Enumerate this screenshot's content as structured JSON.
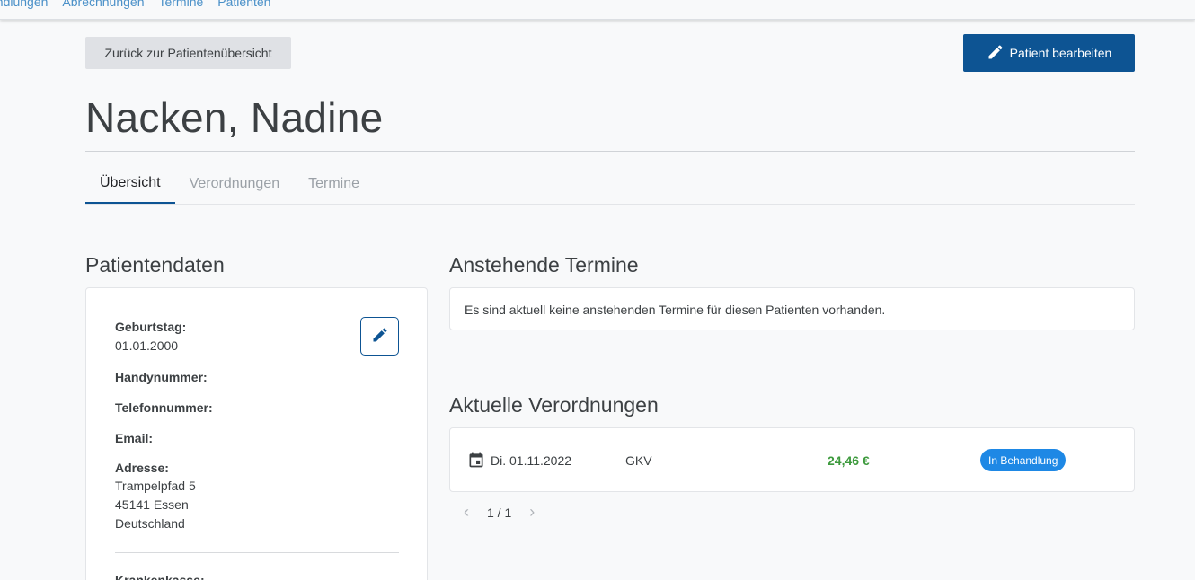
{
  "topnav": {
    "links": [
      "andlungen",
      "Abrechnungen",
      "Termine",
      "Patienten"
    ]
  },
  "header": {
    "back_label": "Zurück zur Patientenübersicht",
    "edit_label": "Patient bearbeiten",
    "title": "Nacken, Nadine"
  },
  "tabs": [
    {
      "label": "Übersicht",
      "active": true
    },
    {
      "label": "Verordnungen",
      "active": false
    },
    {
      "label": "Termine",
      "active": false
    }
  ],
  "patient_data": {
    "heading": "Patientendaten",
    "birthday_label": "Geburtstag:",
    "birthday_value": "01.01.2000",
    "mobile_label": "Handynummer:",
    "phone_label": "Telefonnummer:",
    "email_label": "Email:",
    "address_label": "Adresse:",
    "address_street": "Trampelpfad 5",
    "address_city": "45141 Essen",
    "address_country": "Deutschland",
    "insurance_label": "Krankenkasse:"
  },
  "upcoming": {
    "heading": "Anstehende Termine",
    "empty_message": "Es sind aktuell keine anstehenden Termine für diesen Patienten vorhanden."
  },
  "prescriptions": {
    "heading": "Aktuelle Verordnungen",
    "items": [
      {
        "date": "Di. 01.11.2022",
        "type": "GKV",
        "amount": "24,46 €",
        "status": "In Behandlung"
      }
    ],
    "pagination": "1 / 1"
  },
  "colors": {
    "primary": "#0d5493",
    "amount_green": "#3d9a3d",
    "badge_blue": "#1e88e5"
  },
  "icons": {
    "edit": "pencil-icon",
    "calendar": "calendar-icon",
    "prev": "chevron-left-icon",
    "next": "chevron-right-icon"
  }
}
